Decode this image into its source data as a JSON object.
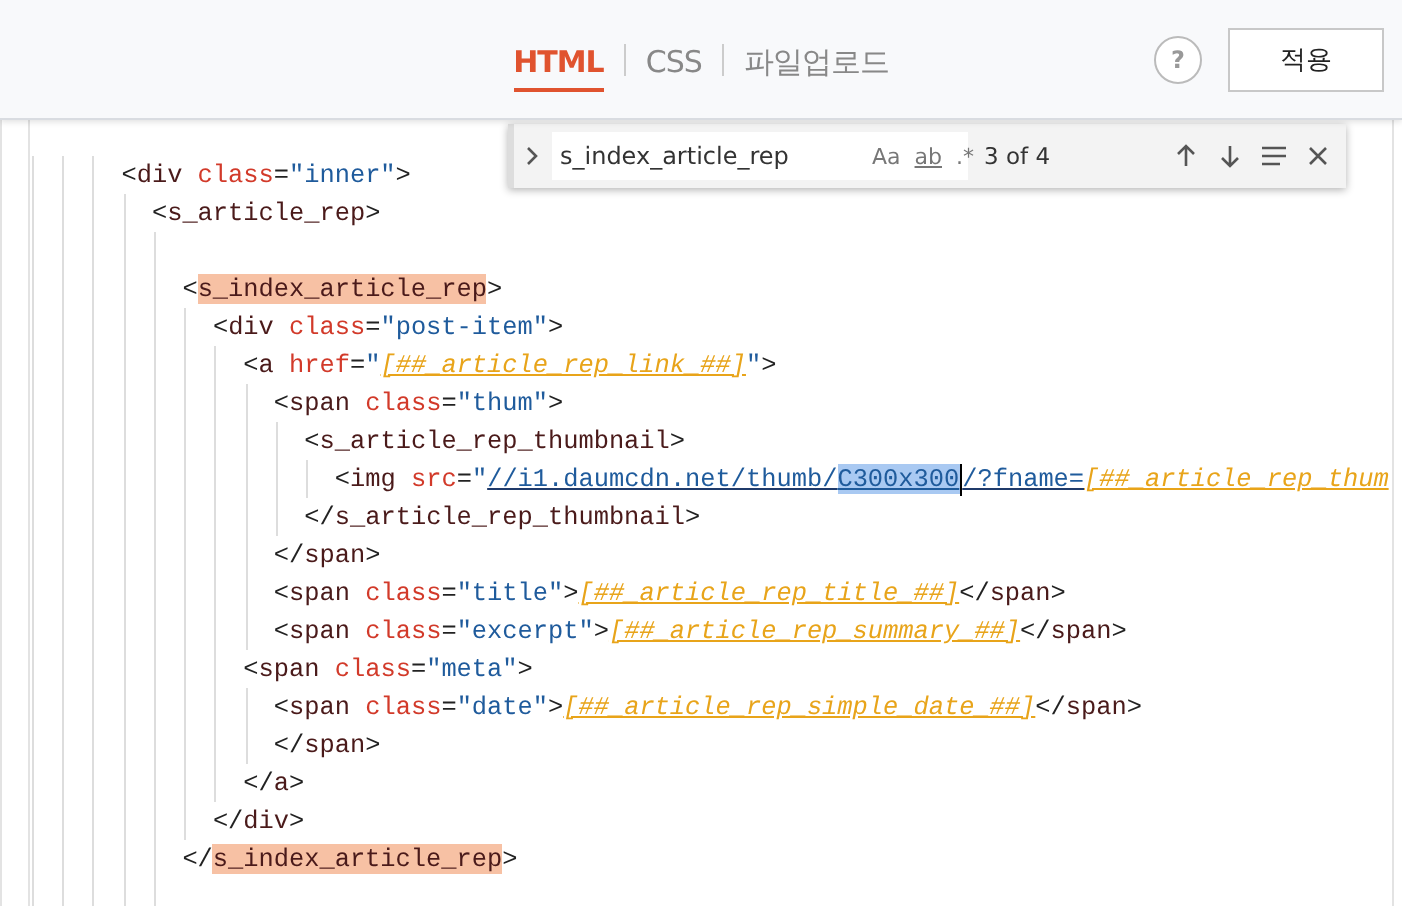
{
  "header": {
    "tabs": [
      {
        "label": "HTML",
        "selected": true
      },
      {
        "label": "CSS",
        "selected": false
      },
      {
        "label": "파일업로드",
        "selected": false
      }
    ],
    "help": "?",
    "apply": "적용"
  },
  "find": {
    "value": "s_index_article_rep",
    "options": [
      {
        "label": "Aa",
        "on": false
      },
      {
        "label": "ab",
        "on": false
      },
      {
        "label": ".*",
        "on": false
      }
    ],
    "count": "3 of 4"
  },
  "code": [
    {
      "kind": "code",
      "tokens": [
        {
          "kind": "punct",
          "text": "<"
        },
        {
          "kind": "tag",
          "text": "div"
        },
        {
          "kind": "attr",
          "text": " class"
        },
        {
          "kind": "punct",
          "text": "="
        },
        {
          "kind": "string",
          "text": "\"inner\""
        },
        {
          "kind": "punct",
          "text": ">"
        }
      ],
      "children": [
        {
          "kind": "code",
          "tokens": [
            {
              "kind": "punct",
              "text": "<"
            },
            {
              "kind": "tag",
              "text": "s_article_rep"
            },
            {
              "kind": "punct",
              "text": ">"
            }
          ],
          "children": [
            {
              "kind": "blank"
            },
            {
              "kind": "code",
              "tokens": [
                {
                  "kind": "punct",
                  "text": "<"
                },
                {
                  "kind": "match",
                  "text": "s_index_article_rep"
                },
                {
                  "kind": "punct",
                  "text": ">"
                }
              ],
              "children": [
                {
                  "kind": "code",
                  "tokens": [
                    {
                      "kind": "punct",
                      "text": "<"
                    },
                    {
                      "kind": "tag",
                      "text": "div"
                    },
                    {
                      "kind": "attr",
                      "text": " class"
                    },
                    {
                      "kind": "punct",
                      "text": "="
                    },
                    {
                      "kind": "string",
                      "text": "\"post-item\""
                    },
                    {
                      "kind": "punct",
                      "text": ">"
                    }
                  ],
                  "children": [
                    {
                      "kind": "code",
                      "tokens": [
                        {
                          "kind": "punct",
                          "text": "<"
                        },
                        {
                          "kind": "tag",
                          "text": "a"
                        },
                        {
                          "kind": "attr",
                          "text": " href"
                        },
                        {
                          "kind": "punct",
                          "text": "="
                        },
                        {
                          "kind": "string",
                          "text": "\""
                        },
                        {
                          "kind": "template",
                          "text": "[##_article_rep_link_##]"
                        },
                        {
                          "kind": "string",
                          "text": "\""
                        },
                        {
                          "kind": "punct",
                          "text": ">"
                        }
                      ],
                      "children": [
                        {
                          "kind": "code",
                          "tokens": [
                            {
                              "kind": "punct",
                              "text": "<"
                            },
                            {
                              "kind": "tag",
                              "text": "span"
                            },
                            {
                              "kind": "attr",
                              "text": " class"
                            },
                            {
                              "kind": "punct",
                              "text": "="
                            },
                            {
                              "kind": "string",
                              "text": "\"thum\""
                            },
                            {
                              "kind": "punct",
                              "text": ">"
                            }
                          ],
                          "children": [
                            {
                              "kind": "code",
                              "tokens": [
                                {
                                  "kind": "punct",
                                  "text": "<"
                                },
                                {
                                  "kind": "tag",
                                  "text": "s_article_rep_thumbnail"
                                },
                                {
                                  "kind": "punct",
                                  "text": ">"
                                }
                              ],
                              "children": [
                                {
                                  "kind": "code",
                                  "caret": true,
                                  "tokens": [
                                    {
                                      "kind": "punct",
                                      "text": "<"
                                    },
                                    {
                                      "kind": "tag",
                                      "text": "img"
                                    },
                                    {
                                      "kind": "attr",
                                      "text": " src"
                                    },
                                    {
                                      "kind": "punct",
                                      "text": "="
                                    },
                                    {
                                      "kind": "string",
                                      "text": "\""
                                    },
                                    {
                                      "kind": "url",
                                      "text": "//i1.daumcdn.net/thumb/"
                                    },
                                    {
                                      "kind": "selection",
                                      "text": "C300x300"
                                    },
                                    {
                                      "kind": "url",
                                      "text": "/?fname="
                                    },
                                    {
                                      "kind": "template",
                                      "text": "[##_article_rep_thum"
                                    }
                                  ]
                                }
                              ]
                            },
                            {
                              "kind": "code",
                              "tokens": [
                                {
                                  "kind": "punct",
                                  "text": "</"
                                },
                                {
                                  "kind": "tag",
                                  "text": "s_article_rep_thumbnail"
                                },
                                {
                                  "kind": "punct",
                                  "text": ">"
                                }
                              ]
                            }
                          ]
                        },
                        {
                          "kind": "code",
                          "tokens": [
                            {
                              "kind": "punct",
                              "text": "</"
                            },
                            {
                              "kind": "tag",
                              "text": "span"
                            },
                            {
                              "kind": "punct",
                              "text": ">"
                            }
                          ]
                        },
                        {
                          "kind": "code",
                          "tokens": [
                            {
                              "kind": "punct",
                              "text": "<"
                            },
                            {
                              "kind": "tag",
                              "text": "span"
                            },
                            {
                              "kind": "attr",
                              "text": " class"
                            },
                            {
                              "kind": "punct",
                              "text": "="
                            },
                            {
                              "kind": "string",
                              "text": "\"title\""
                            },
                            {
                              "kind": "punct",
                              "text": ">"
                            },
                            {
                              "kind": "template",
                              "text": "[##_article_rep_title_##]"
                            },
                            {
                              "kind": "punct",
                              "text": "</"
                            },
                            {
                              "kind": "tag",
                              "text": "span"
                            },
                            {
                              "kind": "punct",
                              "text": ">"
                            }
                          ]
                        },
                        {
                          "kind": "code",
                          "tokens": [
                            {
                              "kind": "punct",
                              "text": "<"
                            },
                            {
                              "kind": "tag",
                              "text": "span"
                            },
                            {
                              "kind": "attr",
                              "text": " class"
                            },
                            {
                              "kind": "punct",
                              "text": "="
                            },
                            {
                              "kind": "string",
                              "text": "\"excerpt\""
                            },
                            {
                              "kind": "punct",
                              "text": ">"
                            },
                            {
                              "kind": "template",
                              "text": "[##_article_rep_summary_##]"
                            },
                            {
                              "kind": "punct",
                              "text": "</"
                            },
                            {
                              "kind": "tag",
                              "text": "span"
                            },
                            {
                              "kind": "punct",
                              "text": ">"
                            }
                          ]
                        }
                      ]
                    },
                    {
                      "kind": "code",
                      "tokens": [
                        {
                          "kind": "punct",
                          "text": "<"
                        },
                        {
                          "kind": "tag",
                          "text": "span"
                        },
                        {
                          "kind": "attr",
                          "text": " class"
                        },
                        {
                          "kind": "punct",
                          "text": "="
                        },
                        {
                          "kind": "string",
                          "text": "\"meta\""
                        },
                        {
                          "kind": "punct",
                          "text": ">"
                        }
                      ],
                      "children": [
                        {
                          "kind": "code",
                          "tokens": [
                            {
                              "kind": "punct",
                              "text": "<"
                            },
                            {
                              "kind": "tag",
                              "text": "span"
                            },
                            {
                              "kind": "attr",
                              "text": " class"
                            },
                            {
                              "kind": "punct",
                              "text": "="
                            },
                            {
                              "kind": "string",
                              "text": "\"date\""
                            },
                            {
                              "kind": "punct",
                              "text": ">"
                            },
                            {
                              "kind": "template",
                              "text": "[##_article_rep_simple_date_##]"
                            },
                            {
                              "kind": "punct",
                              "text": "</"
                            },
                            {
                              "kind": "tag",
                              "text": "span"
                            },
                            {
                              "kind": "punct",
                              "text": ">"
                            }
                          ]
                        },
                        {
                          "kind": "code",
                          "tokens": [
                            {
                              "kind": "punct",
                              "text": "</"
                            },
                            {
                              "kind": "tag",
                              "text": "span"
                            },
                            {
                              "kind": "punct",
                              "text": ">"
                            }
                          ]
                        }
                      ]
                    },
                    {
                      "kind": "code",
                      "tokens": [
                        {
                          "kind": "punct",
                          "text": "</"
                        },
                        {
                          "kind": "tag",
                          "text": "a"
                        },
                        {
                          "kind": "punct",
                          "text": ">"
                        }
                      ]
                    }
                  ]
                },
                {
                  "kind": "code",
                  "tokens": [
                    {
                      "kind": "punct",
                      "text": "</"
                    },
                    {
                      "kind": "tag",
                      "text": "div"
                    },
                    {
                      "kind": "punct",
                      "text": ">"
                    }
                  ]
                }
              ]
            },
            {
              "kind": "code",
              "tokens": [
                {
                  "kind": "punct",
                  "text": "</"
                },
                {
                  "kind": "match",
                  "text": "s_index_article_rep"
                },
                {
                  "kind": "punct",
                  "text": ">"
                }
              ]
            },
            {
              "kind": "blank"
            }
          ]
        }
      ]
    }
  ]
}
